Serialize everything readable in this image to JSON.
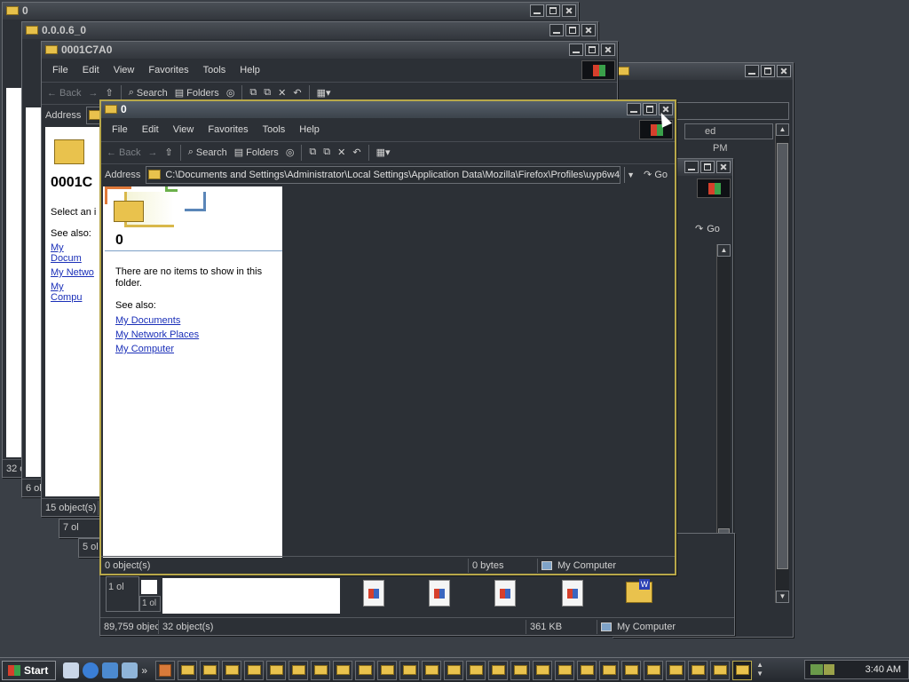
{
  "windows": {
    "w0": {
      "title": "0",
      "status_count": "32 ol"
    },
    "w1": {
      "title": "0.0.0.6_0",
      "status_count": "6 ol"
    },
    "w2": {
      "title": "0001C7A0",
      "status_count": "15 object(s)",
      "heading": "0001C",
      "select_text": "Select an i",
      "see_also": "See also:",
      "links": [
        "My Docum",
        "My Netwo",
        "My Compu"
      ]
    },
    "w3": {
      "status_count": "7 ol"
    },
    "w4": {
      "status_count": "5 ol"
    },
    "right_bg": {
      "time": "PM",
      "field": "ed",
      "go": "Go"
    },
    "bottom_bg": {
      "status": [
        "89,759 objec",
        "32 object(s)",
        "361 KB",
        "My Computer"
      ],
      "stubs": [
        "1 ol",
        "1 ol"
      ]
    }
  },
  "active_window": {
    "title": "0",
    "menu": [
      "File",
      "Edit",
      "View",
      "Favorites",
      "Tools",
      "Help"
    ],
    "toolbar": {
      "back": "Back",
      "search": "Search",
      "folders": "Folders"
    },
    "address": {
      "label": "Address",
      "value": "C:\\Documents and Settings\\Administrator\\Local Settings\\Application Data\\Mozilla\\Firefox\\Profiles\\uyp6w4",
      "go": "Go"
    },
    "left_pane": {
      "folder_name": "0",
      "empty_message": "There are no items to show in this folder.",
      "see_also": "See also:",
      "links": [
        "My Documents",
        "My Network Places",
        "My Computer"
      ]
    },
    "status": {
      "objects": "0 object(s)",
      "size": "0 bytes",
      "location": "My Computer"
    }
  },
  "back_menu": [
    "File",
    "Edit",
    "View",
    "Favorites",
    "Tools",
    "Help"
  ],
  "back_toolbar": {
    "back": "Back",
    "search": "Search",
    "folders": "Folders"
  },
  "back_address_label": "Address",
  "taskbar": {
    "start": "Start",
    "clock": "3:40 AM",
    "more": "»",
    "folder_buttons": 27
  },
  "colors": {
    "background": "#3a3f46",
    "window": "#2c3036",
    "active_border": "#b8a84a",
    "link": "#1a2fb8"
  },
  "icons": [
    "folder-icon",
    "windows-logo-icon",
    "search-icon",
    "folders-icon",
    "back-icon",
    "forward-icon",
    "up-icon",
    "go-arrow-icon",
    "my-computer-icon"
  ]
}
